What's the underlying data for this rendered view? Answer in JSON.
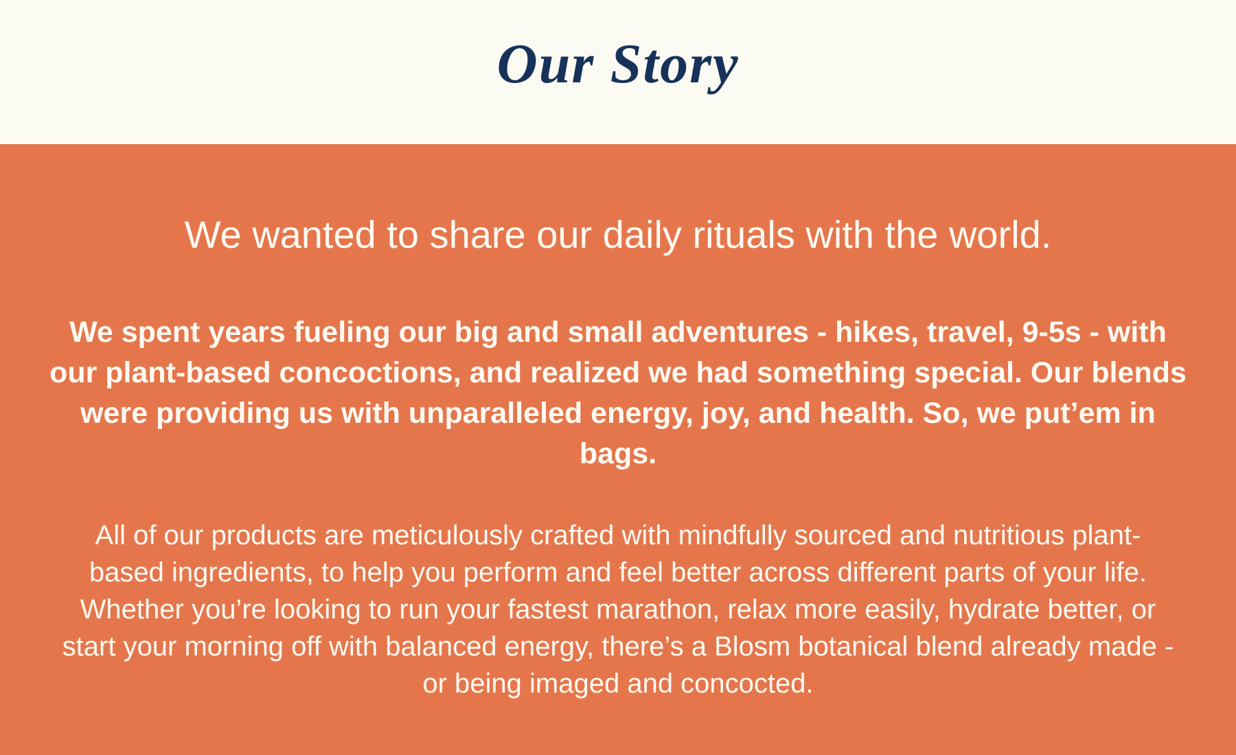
{
  "header": {
    "title": "Our Story"
  },
  "story": {
    "headline": "We wanted to share our daily rituals with the world.",
    "lead": "We spent years fueling our big and small adventures - hikes, travel, 9-5s - with our plant-based concoctions, and realized we had something special. Our blends were providing us with unparalleled energy, joy, and health. So, we put’em in bags.",
    "body": "All of our products are meticulously crafted with mindfully sourced and nutritious plant-based ingredients, to help you perform and feel better across different parts of your life. Whether you’re looking to run your fastest marathon, relax more easily, hydrate better, or start your morning off with balanced energy, there’s a Blosm botanical blend already made - or being imaged and concocted."
  },
  "colors": {
    "header_background": "#fcfbf3",
    "title": "#17325a",
    "section_background": "#e5764c",
    "section_text": "#fffaf2"
  }
}
